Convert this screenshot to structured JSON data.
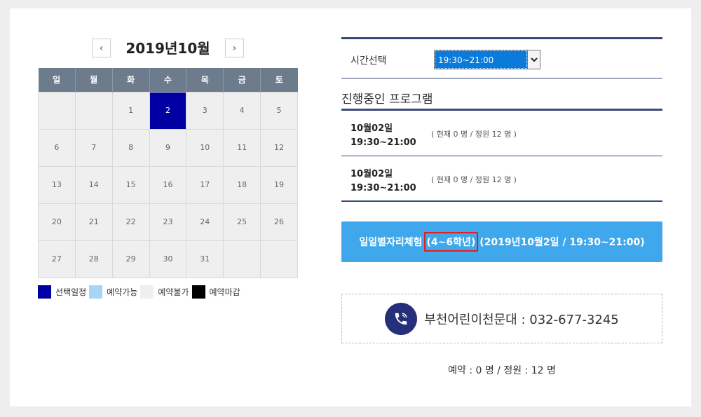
{
  "calendar": {
    "prev_label": "‹",
    "next_label": "›",
    "title": "2019년10월",
    "weekdays": [
      "일",
      "월",
      "화",
      "수",
      "목",
      "금",
      "토"
    ],
    "weeks": [
      [
        "",
        "",
        "1",
        "2",
        "3",
        "4",
        "5"
      ],
      [
        "6",
        "7",
        "8",
        "9",
        "10",
        "11",
        "12"
      ],
      [
        "13",
        "14",
        "15",
        "16",
        "17",
        "18",
        "19"
      ],
      [
        "20",
        "21",
        "22",
        "23",
        "24",
        "25",
        "26"
      ],
      [
        "27",
        "28",
        "29",
        "30",
        "31",
        "",
        ""
      ]
    ],
    "selected_day": "2",
    "selected_color": "#0000a2"
  },
  "legend": [
    {
      "label": "선택일정",
      "color": "#0000a2"
    },
    {
      "label": "예약가능",
      "color": "#a8d4f5"
    },
    {
      "label": "예약불가",
      "color": "#efefef"
    },
    {
      "label": "예약마감",
      "color": "#000000"
    }
  ],
  "time_select": {
    "label": "시간선택",
    "value": "19:30~21:00"
  },
  "programs": {
    "section_title": "진행중인 프로그램",
    "items": [
      {
        "date": "10월02일",
        "time": "19:30~21:00",
        "capacity": "( 현재 0 명 / 정원 12 명 )"
      },
      {
        "date": "10월02일",
        "time": "19:30~21:00",
        "capacity": "( 현재 0 명 / 정원 12 명 )"
      }
    ]
  },
  "reserve_button": {
    "prefix": "일일별자리체험",
    "grade": "(4~6학년)",
    "suffix": "(2019년10월2일 / 19:30~21:00)",
    "color": "#3fa8ec"
  },
  "contact": {
    "text": "부천어린이천문대 : 032-677-3245",
    "icon": "phone-icon"
  },
  "summary": "예약 : 0 명 / 정원 : 12 명"
}
